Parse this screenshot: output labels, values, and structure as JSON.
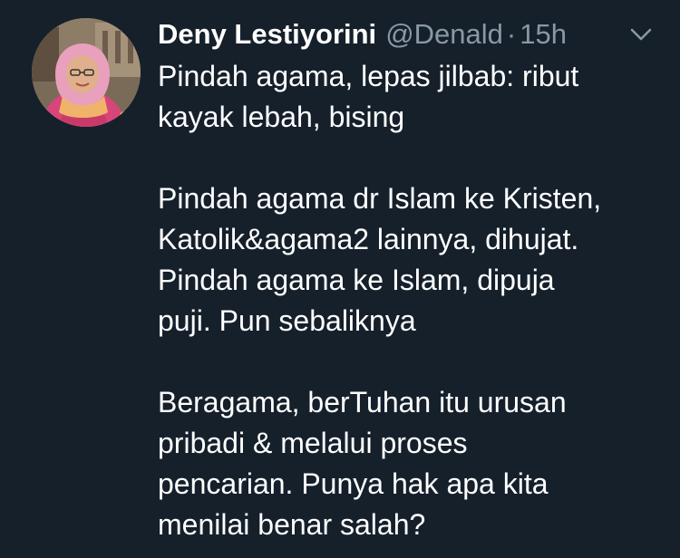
{
  "tweet": {
    "display_name": "Deny Lestiyorini",
    "handle": "@Denald",
    "separator": "·",
    "time": "15h",
    "body": {
      "paragraph_1": [
        "Pindah agama, lepas jilbab: ribut",
        "kayak lebah, bising"
      ],
      "paragraph_2": [
        "Pindah agama dr Islam ke Kristen,",
        "Katolik&agama2 lainnya, dihujat.",
        "Pindah agama ke Islam, dipuja",
        "puji. Pun sebaliknya"
      ],
      "paragraph_3": [
        "Beragama, berTuhan itu urusan",
        "pribadi & melalui proses",
        "pencarian. Punya hak apa kita",
        "menilai benar salah?"
      ]
    },
    "icons": {
      "avatar": "avatar-photo",
      "menu": "chevron-down-icon"
    },
    "colors": {
      "background": "#15202b",
      "primary_text": "#ffffff",
      "secondary_text": "#8899a6"
    }
  }
}
